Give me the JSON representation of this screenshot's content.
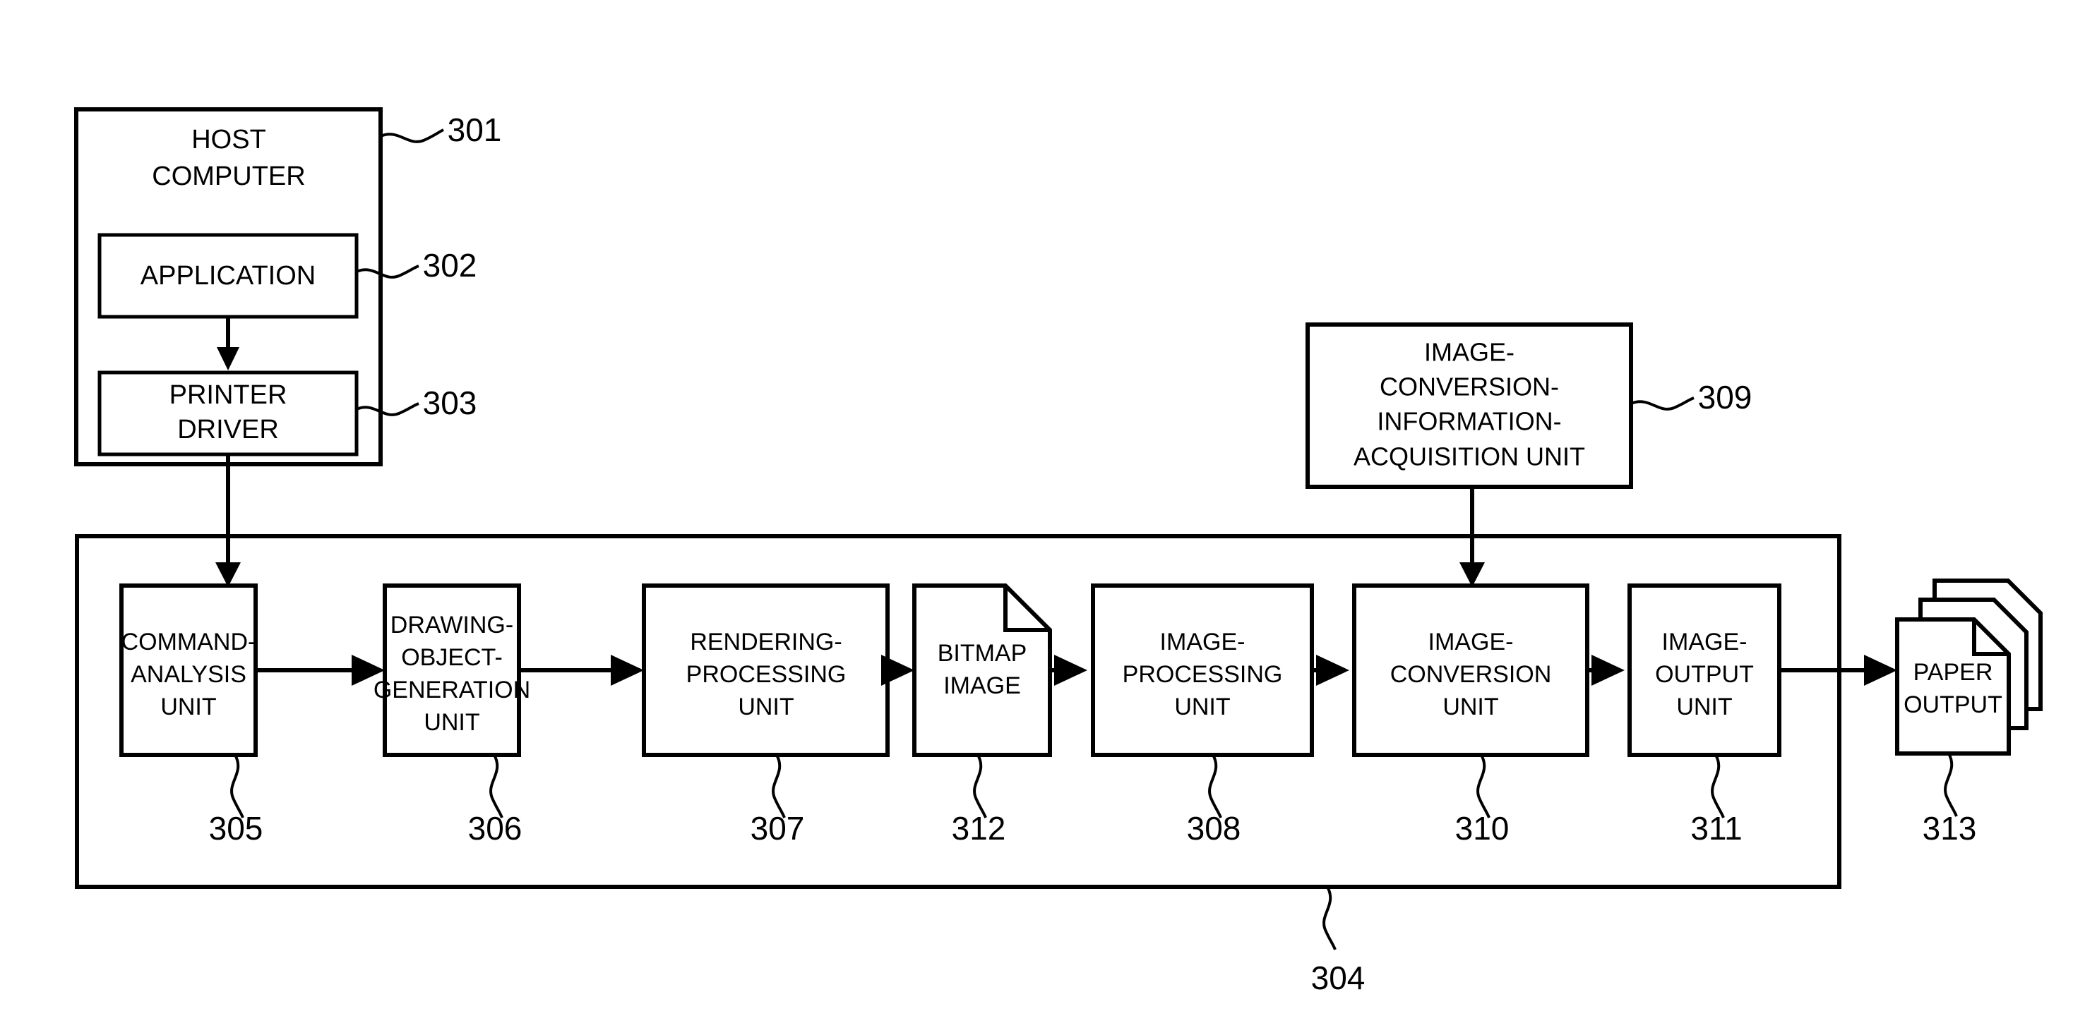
{
  "figure": {
    "type": "patent-block-diagram",
    "background_color": "#ffffff",
    "line_color": "#000000"
  },
  "host_computer": {
    "title_line1": "HOST",
    "title_line2": "COMPUTER",
    "ref": "301",
    "application": {
      "label": "APPLICATION",
      "ref": "302"
    },
    "printer_driver": {
      "label_line1": "PRINTER",
      "label_line2": "DRIVER",
      "ref": "303"
    }
  },
  "acquisition_unit": {
    "line1": "IMAGE-",
    "line2": "CONVERSION-",
    "line3": "INFORMATION-",
    "line4": "ACQUISITION UNIT",
    "ref": "309"
  },
  "printer_container": {
    "ref": "304"
  },
  "pipeline": {
    "blocks": [
      {
        "name": "command-analysis-unit",
        "lines": [
          "COMMAND-",
          "ANALYSIS",
          "UNIT"
        ],
        "ref": "305",
        "shape": "rect"
      },
      {
        "name": "drawing-object-generation-unit",
        "lines": [
          "DRAWING-",
          "OBJECT-",
          "GENERATION",
          "UNIT"
        ],
        "ref": "306",
        "shape": "rect"
      },
      {
        "name": "rendering-processing-unit",
        "lines": [
          "RENDERING-",
          "PROCESSING",
          "UNIT"
        ],
        "ref": "307",
        "shape": "rect"
      },
      {
        "name": "bitmap-image",
        "lines": [
          "BITMAP",
          "IMAGE"
        ],
        "ref": "312",
        "shape": "document"
      },
      {
        "name": "image-processing-unit",
        "lines": [
          "IMAGE-",
          "PROCESSING",
          "UNIT"
        ],
        "ref": "308",
        "shape": "rect"
      },
      {
        "name": "image-conversion-unit",
        "lines": [
          "IMAGE-",
          "CONVERSION",
          "UNIT"
        ],
        "ref": "310",
        "shape": "rect"
      },
      {
        "name": "image-output-unit",
        "lines": [
          "IMAGE-",
          "OUTPUT",
          "UNIT"
        ],
        "ref": "311",
        "shape": "rect"
      }
    ]
  },
  "paper_output": {
    "line1": "PAPER",
    "line2": "OUTPUT",
    "ref": "313"
  }
}
